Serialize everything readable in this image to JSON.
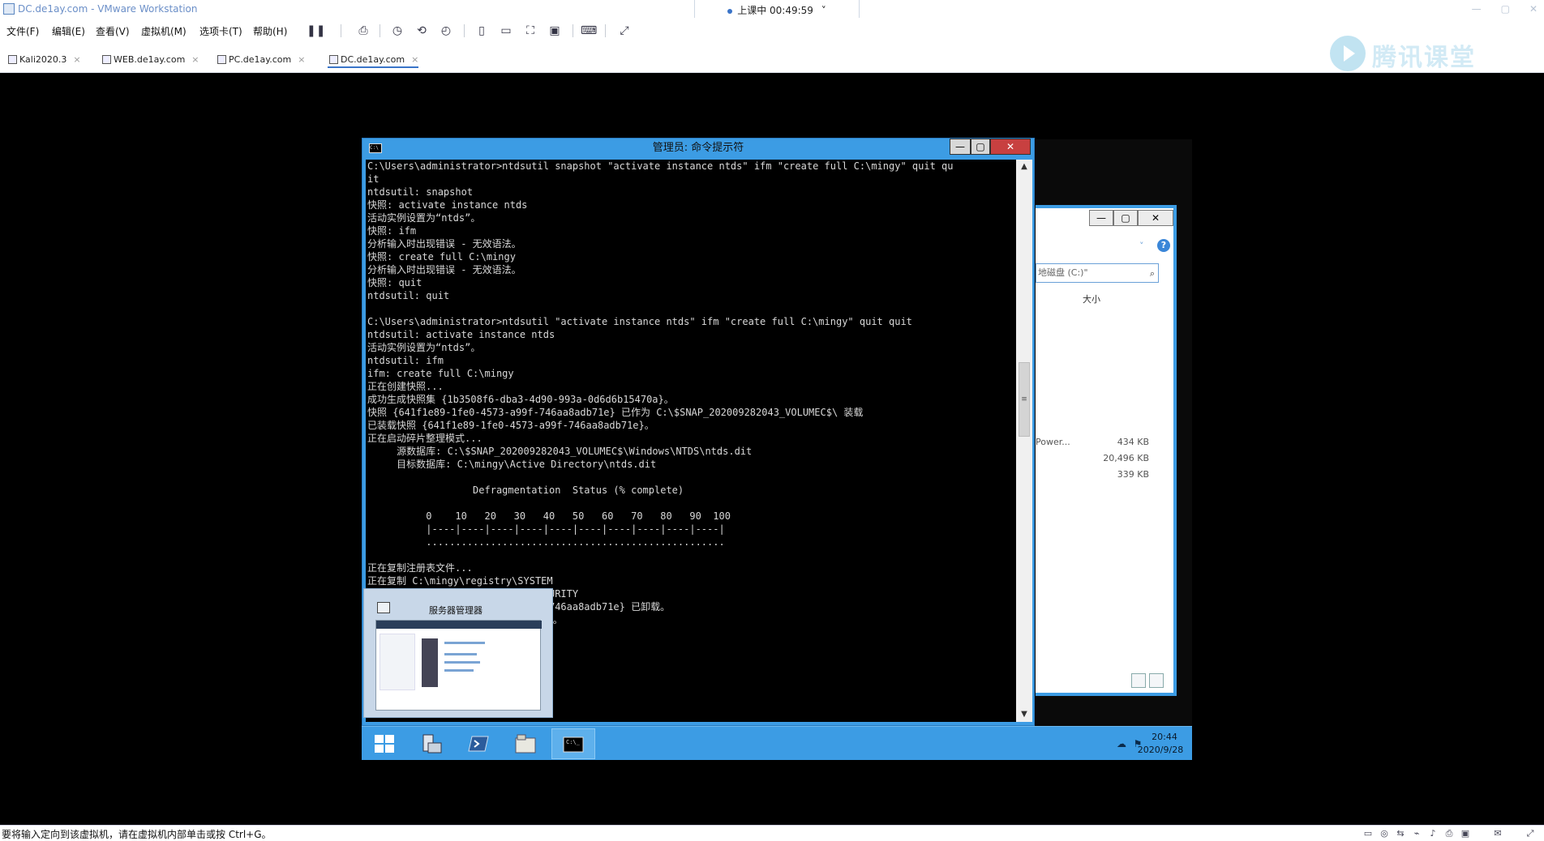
{
  "vmware": {
    "title": "DC.de1ay.com - VMware Workstation",
    "lesson_status": "上课中 00:49:59",
    "lesson_chevron": "˅",
    "window_controls": [
      "—",
      "▢",
      "✕"
    ],
    "menu": [
      "文件(F)",
      "编辑(E)",
      "查看(V)",
      "虚拟机(M)",
      "选项卡(T)",
      "帮助(H)"
    ],
    "toolbar_icons": [
      "pause-icon",
      "send-ctrl-alt-del-icon",
      "snapshot-icon",
      "revert-snapshot-icon",
      "snapshot-manager-icon",
      "sidebar-icon",
      "thumbnail-bar-icon",
      "fit-guest-icon",
      "unity-icon",
      "console-icon",
      "fullscreen-icon"
    ],
    "tabs": [
      {
        "label": "Kali2020.3"
      },
      {
        "label": "WEB.de1ay.com"
      },
      {
        "label": "PC.de1ay.com"
      },
      {
        "label": "DC.de1ay.com"
      }
    ],
    "tab_close": "×",
    "brand_text": "腾讯课堂",
    "statusbar_text": "要将输入定向到该虚拟机，请在虚拟机内部单击或按 Ctrl+G。"
  },
  "cmd": {
    "title": "管理员: 命令提示符",
    "icon_text": "C:\\",
    "window_controls": [
      "—",
      "▢",
      "✕"
    ],
    "lines": [
      "C:\\Users\\administrator>ntdsutil snapshot \"activate instance ntds\" ifm \"create full C:\\mingy\" quit qu",
      "it",
      "ntdsutil: snapshot",
      "快照: activate instance ntds",
      "活动实例设置为“ntds”。",
      "快照: ifm",
      "分析输入时出现错误 - 无效语法。",
      "快照: create full C:\\mingy",
      "分析输入时出现错误 - 无效语法。",
      "快照: quit",
      "ntdsutil: quit",
      "",
      "C:\\Users\\administrator>ntdsutil \"activate instance ntds\" ifm \"create full C:\\mingy\" quit quit",
      "ntdsutil: activate instance ntds",
      "活动实例设置为“ntds”。",
      "ntdsutil: ifm",
      "ifm: create full C:\\mingy",
      "正在创建快照...",
      "成功生成快照集 {1b3508f6-dba3-4d90-993a-0d6d6b15470a}。",
      "快照 {641f1e89-1fe0-4573-a99f-746aa8adb71e} 已作为 C:\\$SNAP_202009282043_VOLUMEC$\\ 装载",
      "已装载快照 {641f1e89-1fe0-4573-a99f-746aa8adb71e}。",
      "正在启动碎片整理模式...",
      "     源数据库: C:\\$SNAP_202009282043_VOLUMEC$\\Windows\\NTDS\\ntds.dit",
      "     目标数据库: C:\\mingy\\Active Directory\\ntds.dit",
      "",
      "                  Defragmentation  Status (% complete)",
      "",
      "          0    10   20   30   40   50   60   70   80   90  100",
      "          |----|----|----|----|----|----|----|----|----|----|",
      "          ...................................................",
      "",
      "正在复制注册表文件...",
      "正在复制 C:\\mingy\\registry\\SYSTEM",
      "                              CURITY",
      "                              -746aa8adb71e} 已卸载。",
      "                              体。"
    ],
    "scroll_up": "▲",
    "scroll_down": "▼",
    "scroll_grip": "≡"
  },
  "explorer": {
    "window_controls": [
      "—",
      "▢",
      "✕"
    ],
    "nav_chevron": "˅",
    "help": "?",
    "search_placeholder": "地磁盘 (C:)\"",
    "search_glyph": "⌕",
    "size_header": "大小",
    "rows": [
      {
        "name": "Power...",
        "size": "434 KB"
      },
      {
        "name": "",
        "size": "20,496 KB"
      },
      {
        "name": "",
        "size": "339 KB"
      }
    ]
  },
  "thumbnail": {
    "title": "服务器管理器"
  },
  "taskbar": {
    "time": "20:44",
    "date": "2020/9/28",
    "tray_icons": [
      "network-icon",
      "flag-icon"
    ],
    "tray_glyphs": [
      "☁",
      "⚑"
    ],
    "apps": [
      "start-button",
      "server-manager-button",
      "powershell-button",
      "file-explorer-button",
      "cmd-button"
    ],
    "cmd_glyph": "C:\\_"
  },
  "statusbar_icons": [
    "hdd-icon",
    "cd-icon",
    "network-icon",
    "usb-icon",
    "sound-icon",
    "printer-icon",
    "display-icon",
    "message-icon",
    "fullscreen-icon"
  ],
  "statusbar_glyphs": [
    "▭",
    "◎",
    "⇆",
    "⌁",
    "♪",
    "⎙",
    "▣",
    "✉",
    "⤢"
  ],
  "toolbar_glyphs": [
    "❚❚",
    "⎙",
    "◷",
    "⟲",
    "◴",
    "▯",
    "▭",
    "⛶",
    "▣",
    "⌨",
    "⤢"
  ],
  "colors": {
    "guest_accent": "#3c9ce4",
    "cmd_bg": "#000000",
    "cmd_text": "#d8d8d8"
  }
}
